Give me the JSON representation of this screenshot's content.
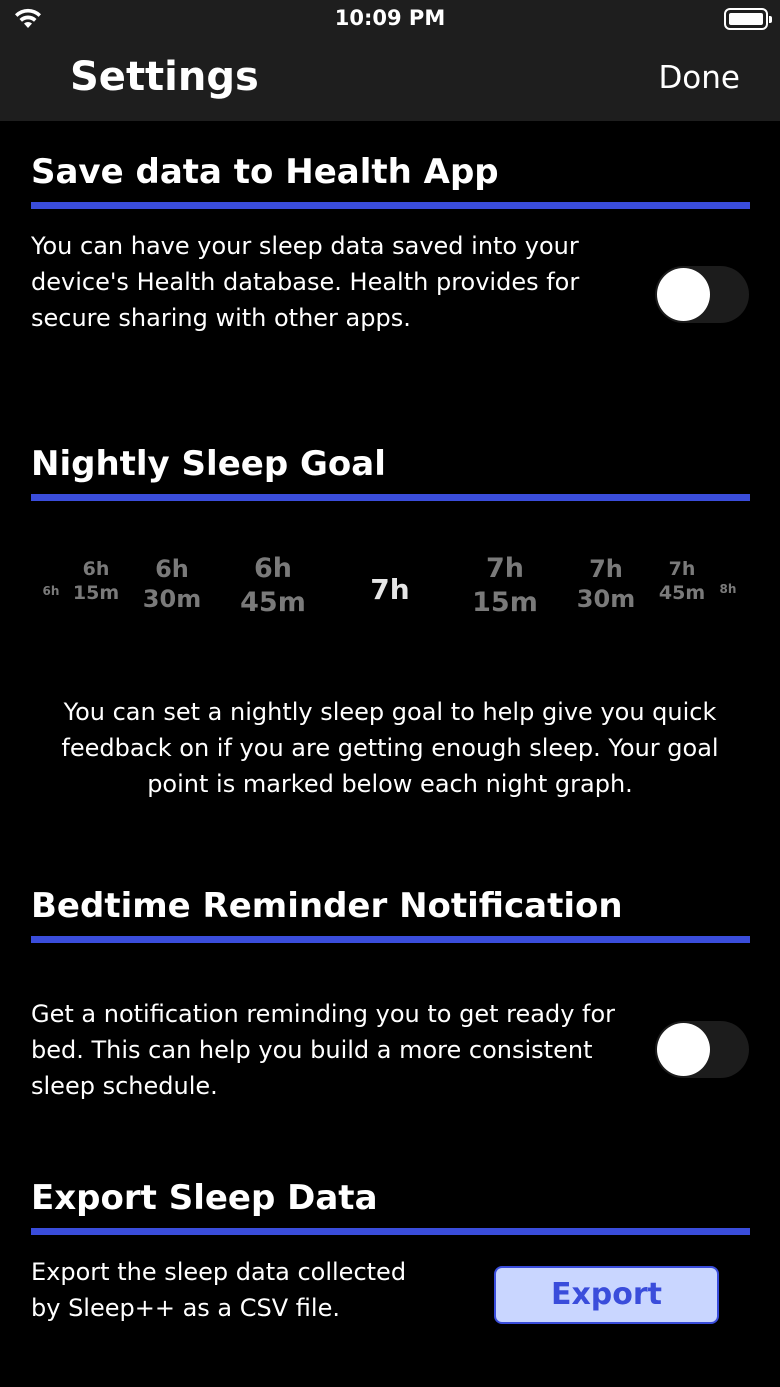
{
  "status_bar": {
    "time": "10:09 PM"
  },
  "nav": {
    "title": "Settings",
    "done_label": "Done"
  },
  "health": {
    "title": "Save data to Health App",
    "description": [
      "You can have your sleep data saved into your",
      "device's Health database. Health provides for",
      "secure sharing with other apps."
    ],
    "toggle_on": false
  },
  "goal": {
    "title": "Nightly Sleep Goal",
    "options": [
      {
        "line1": "6h",
        "line2": ""
      },
      {
        "line1": "6h",
        "line2": "15m"
      },
      {
        "line1": "6h",
        "line2": "30m"
      },
      {
        "line1": "6h",
        "line2": "45m"
      },
      {
        "line1": "7h",
        "line2": ""
      },
      {
        "line1": "7h",
        "line2": "15m"
      },
      {
        "line1": "7h",
        "line2": "30m"
      },
      {
        "line1": "7h",
        "line2": "45m"
      },
      {
        "line1": "8h",
        "line2": ""
      }
    ],
    "selected": "7h",
    "description": [
      "You can set a nightly sleep goal to help give you quick",
      "feedback on if you are getting enough sleep. Your goal",
      "point is marked below each night graph."
    ]
  },
  "bedtime": {
    "title": "Bedtime Reminder Notification",
    "description": [
      "Get a notification reminding you to get ready for",
      "bed.  This can help you build a more consistent",
      "sleep schedule."
    ],
    "toggle_on": false
  },
  "export": {
    "title": "Export Sleep Data",
    "description": [
      "Export the sleep data collected",
      "by Sleep++ as a CSV file."
    ],
    "button_label": "Export"
  },
  "colors": {
    "accent": "#3a4ddb",
    "nav_bg": "#1e1e1e",
    "button_bg": "#c9d6ff"
  },
  "icons": {
    "wifi": "wifi-icon",
    "battery": "battery-icon"
  }
}
